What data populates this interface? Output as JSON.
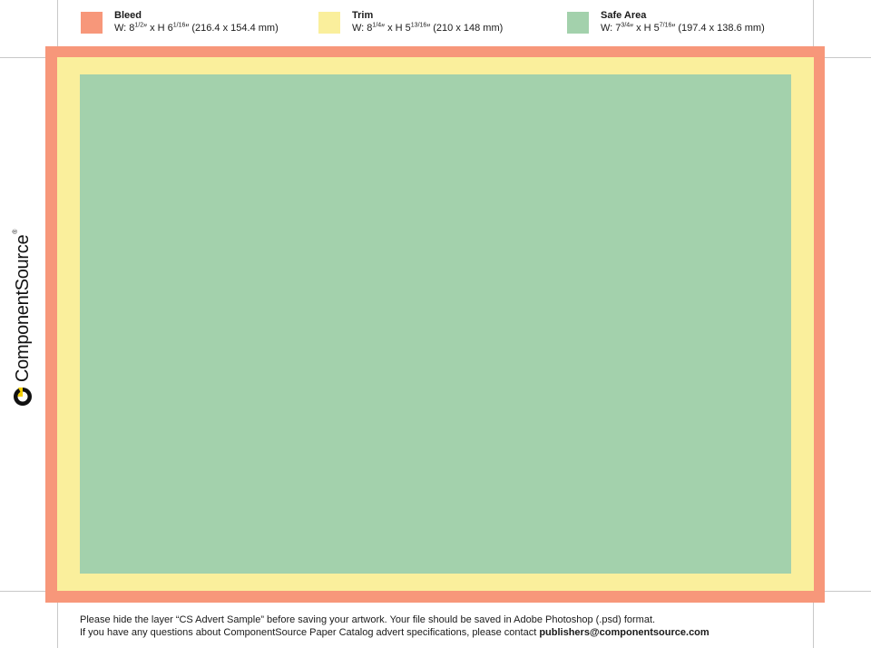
{
  "legend": [
    {
      "title": "Bleed",
      "w_prefix": "W: 8",
      "w_frac": "1/2",
      "mid": "″ x H 6",
      "h_frac": "1/16",
      "suffix": "″ (216.4 x 154.4 mm)",
      "color": "#F7977A"
    },
    {
      "title": "Trim",
      "w_prefix": "W: 8",
      "w_frac": "1/4",
      "mid": "″ x H 5",
      "h_frac": "13/16",
      "suffix": "″ (210 x 148 mm)",
      "color": "#FAEF9C"
    },
    {
      "title": "Safe Area",
      "w_prefix": "W: 7",
      "w_frac": "3/4",
      "mid": "″ x H 5",
      "h_frac": "7/16",
      "suffix": "″ (197.4 x 138.6 mm)",
      "color": "#A3D1AC"
    }
  ],
  "logo": {
    "text": "ComponentSource",
    "reg": "®",
    "mark_color": "#111111",
    "mark_accent": "#F5D000"
  },
  "footer": {
    "line1": "Please hide the layer “CS Advert Sample” before saving your artwork. Your file should be saved in Adobe Photoshop (.psd) format.",
    "line2_prefix": "If you have any questions about ComponentSource Paper Catalog advert specifications, please contact ",
    "email": "publishers@componentsource.com"
  }
}
